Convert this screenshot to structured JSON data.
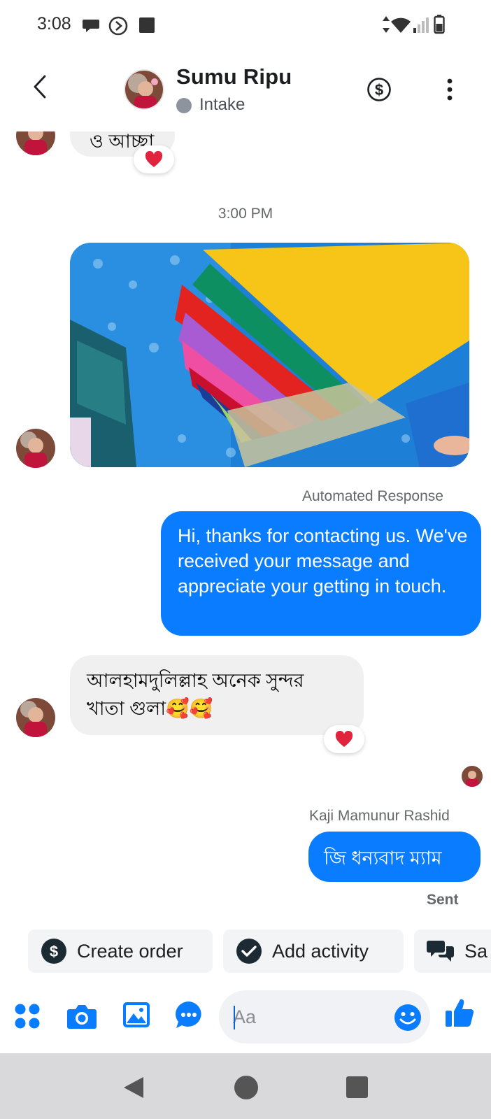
{
  "status_bar": {
    "time": "3:08"
  },
  "header": {
    "contact_name": "Sumu Ripu",
    "status": "Intake"
  },
  "messages": {
    "partial_text": "ও আচ্ছা",
    "timestamp": "3:00 PM",
    "automated_label": "Automated Response",
    "automated_text": "Hi, thanks for contacting us. We've received your message and appreciate your getting in touch.",
    "incoming_text_line1": "আলহামদুলিল্লাহ  অনেক সুন্দর",
    "incoming_text_line2": "খাতা গুলা🥰🥰",
    "sender_label": "Kaji Mamunur Rashid",
    "outgoing_text": "জি ধন্যবাদ ম্যাম",
    "sent_label": "Sent"
  },
  "quick_actions": {
    "create_order": "Create order",
    "add_activity": "Add activity",
    "saved": "Sa"
  },
  "composer": {
    "placeholder": "Aa"
  },
  "colors": {
    "accent": "#0a7cff",
    "bubble_in": "#f0f0f0",
    "reaction": "#e0243e"
  }
}
